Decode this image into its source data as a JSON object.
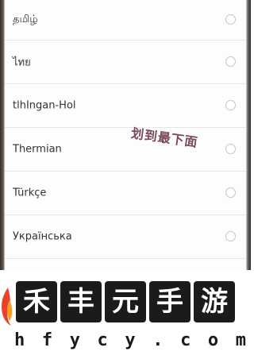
{
  "language_list": {
    "items": [
      {
        "label": "தமிழ்",
        "selected": false
      },
      {
        "label": "ไทย",
        "selected": false
      },
      {
        "label": "tlhIngan-Hol",
        "selected": false
      },
      {
        "label": "Thermian",
        "selected": false
      },
      {
        "label": "Türkçe",
        "selected": false
      },
      {
        "label": "Українська",
        "selected": false
      }
    ]
  },
  "annotation": {
    "text": "划到最下面"
  },
  "watermark": {
    "chars": [
      "禾",
      "丰",
      "元",
      "手",
      "游"
    ],
    "domain": "hfycy.com",
    "domain_letters": [
      "h",
      "f",
      "y",
      "c",
      "y",
      ".",
      "c",
      "o",
      "m"
    ]
  },
  "colors": {
    "radio_border": "#c4c4c4",
    "divider": "#e6e6e6",
    "text": "#333333",
    "annotation": "#7a4a5a",
    "watermark_block": "#1b1b1b"
  }
}
